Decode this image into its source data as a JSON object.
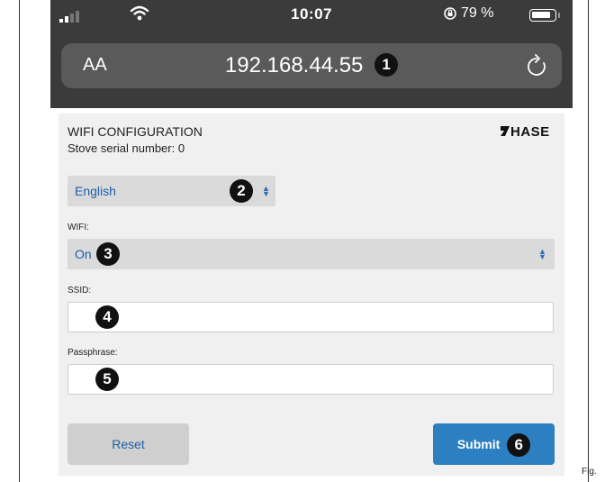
{
  "status_bar": {
    "time": "10:07",
    "battery": "79 %"
  },
  "url_bar": {
    "text_size_label": "AA",
    "url": "192.168.44.55",
    "callout": "1"
  },
  "form": {
    "title": "WIFI CONFIGURATION",
    "serial": "Stove serial number: 0",
    "logo": "HASE",
    "language": {
      "value": "English",
      "callout": "2"
    },
    "wifi": {
      "label": "WIFI:",
      "value": "On",
      "callout": "3"
    },
    "ssid": {
      "label": "SSID:",
      "value": "",
      "callout": "4"
    },
    "passphrase": {
      "label": "Passphrase:",
      "value": "",
      "callout": "5"
    },
    "reset_label": "Reset",
    "submit_label": "Submit",
    "submit_callout": "6"
  },
  "figure_caption": "Fig.",
  "colors": {
    "browser_chrome": "#3b3b3b",
    "select_text": "#1f5fa8",
    "submit_bg": "#2c7fc0"
  }
}
